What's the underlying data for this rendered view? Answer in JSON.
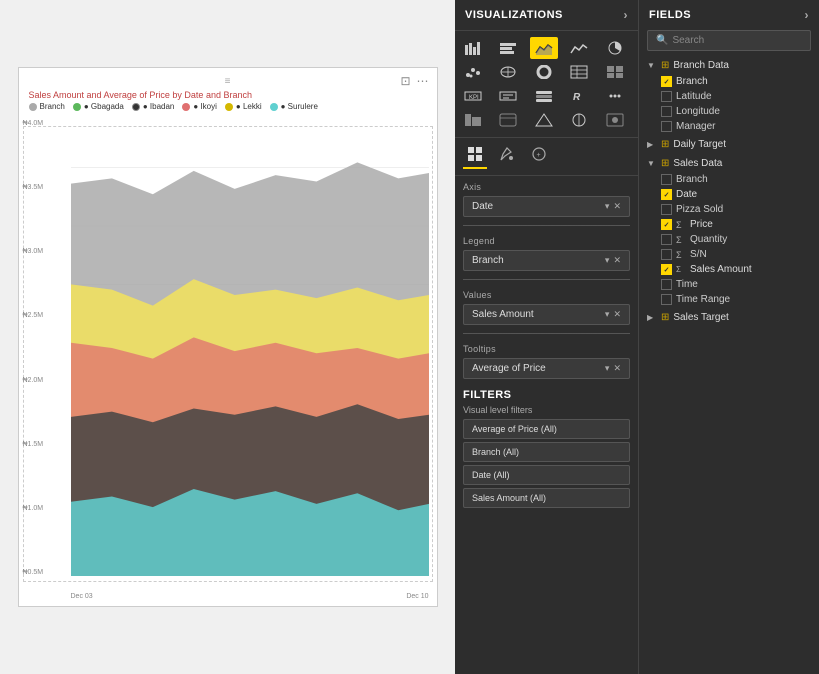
{
  "chart": {
    "title": "Sales Amount and Average of Price by Date and Branch",
    "y_labels": [
      "₦4.0M",
      "₦3.5M",
      "₦3.0M",
      "₦2.5M",
      "₦2.0M",
      "₦1.5M",
      "₦1.0M",
      "₦0.5M"
    ],
    "x_labels": [
      "Dec 03",
      "Dec 10"
    ],
    "legend": [
      {
        "name": "Branch",
        "color": "#aaa"
      },
      {
        "name": "Gbagada",
        "color": "#5cb85c"
      },
      {
        "name": "Ibadan",
        "color": "#333"
      },
      {
        "name": "Ikoyi",
        "color": "#e07070"
      },
      {
        "name": "Lekki",
        "color": "#f0e060"
      },
      {
        "name": "Surulere",
        "color": "#60d0d0"
      }
    ],
    "handle_icon": "≡",
    "toolbar_icons": [
      "⊡",
      "⋯"
    ]
  },
  "visualizations": {
    "header": "VISUALIZATIONS",
    "chevron": "›",
    "icon_rows": [
      [
        "▦",
        "▤",
        "▥",
        "▧",
        "▨"
      ],
      [
        "◱",
        "◲",
        "◳",
        "◴",
        "◵"
      ],
      [
        "◼",
        "◻",
        "▣",
        "▤",
        "◉"
      ],
      [
        "◈",
        "◇",
        "◆",
        "◉",
        "▲"
      ]
    ],
    "tabs": [
      {
        "id": "fields",
        "icon": "⊞",
        "active": true
      },
      {
        "id": "format",
        "icon": "🖌"
      },
      {
        "id": "analytics",
        "icon": "⊕"
      }
    ],
    "axis_label": "Axis",
    "axis_value": "Date",
    "legend_label": "Legend",
    "legend_value": "Branch",
    "values_label": "Values",
    "values_value": "Sales Amount",
    "tooltips_label": "Tooltips",
    "tooltips_value": "Average of Price",
    "filters": {
      "header": "FILTERS",
      "sub": "Visual level filters",
      "items": [
        "Average of Price  (All)",
        "Branch  (All)",
        "Date  (All)",
        "Sales Amount  (All)"
      ]
    }
  },
  "fields": {
    "header": "FIELDS",
    "chevron": "›",
    "search_placeholder": "Search",
    "groups": [
      {
        "name": "Branch Data",
        "expanded": true,
        "chevron": "▼",
        "items": [
          {
            "name": "Branch",
            "checked": true,
            "sigma": false
          },
          {
            "name": "Latitude",
            "checked": false,
            "sigma": false
          },
          {
            "name": "Longitude",
            "checked": false,
            "sigma": false
          },
          {
            "name": "Manager",
            "checked": false,
            "sigma": false
          }
        ]
      },
      {
        "name": "Daily Target",
        "expanded": false,
        "chevron": "▶",
        "items": []
      },
      {
        "name": "Sales Data",
        "expanded": true,
        "chevron": "▼",
        "items": [
          {
            "name": "Branch",
            "checked": false,
            "sigma": false
          },
          {
            "name": "Date",
            "checked": true,
            "sigma": false
          },
          {
            "name": "Pizza Sold",
            "checked": false,
            "sigma": false
          },
          {
            "name": "Price",
            "checked": true,
            "sigma": true
          },
          {
            "name": "Quantity",
            "checked": false,
            "sigma": true
          },
          {
            "name": "S/N",
            "checked": false,
            "sigma": true
          },
          {
            "name": "Sales Amount",
            "checked": true,
            "sigma": false,
            "sum": true
          },
          {
            "name": "Time",
            "checked": false,
            "sigma": false
          },
          {
            "name": "Time Range",
            "checked": false,
            "sigma": false
          }
        ]
      },
      {
        "name": "Sales Target",
        "expanded": false,
        "chevron": "▶",
        "items": []
      }
    ]
  }
}
